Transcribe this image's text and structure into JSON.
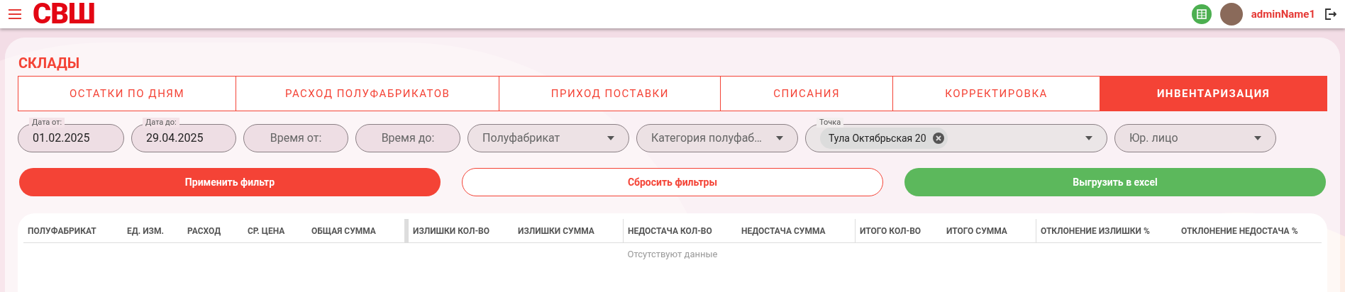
{
  "header": {
    "logo": "СВШ",
    "user": "adminName1"
  },
  "page": {
    "title": "СКЛАДЫ"
  },
  "tabs": [
    {
      "label": "ОСТАТКИ ПО ДНЯМ",
      "selected": false
    },
    {
      "label": "РАСХОД ПОЛУФАБРИКАТОВ",
      "selected": false
    },
    {
      "label": "ПРИХОД ПОСТАВКИ",
      "selected": false
    },
    {
      "label": "СПИСАНИЯ",
      "selected": false
    },
    {
      "label": "КОРРЕКТИРОВКА",
      "selected": false
    },
    {
      "label": "ИНВЕНТАРИЗАЦИЯ",
      "selected": true
    }
  ],
  "filters": [
    {
      "kind": "date",
      "label": "Дата от:",
      "value": "01.02.2025"
    },
    {
      "kind": "date",
      "label": "Дата до:",
      "value": "29.04.2025"
    },
    {
      "kind": "text",
      "placeholder": "Время от:"
    },
    {
      "kind": "text",
      "placeholder": "Время до:"
    },
    {
      "kind": "select",
      "placeholder": "Полуфабрикат"
    },
    {
      "kind": "select",
      "placeholder": "Категория полуфаб…"
    },
    {
      "kind": "chips",
      "label": "Точка",
      "chips": [
        "Тула Октябрьская 20"
      ]
    },
    {
      "kind": "select",
      "placeholder": "Юр. лицо"
    }
  ],
  "buttons": [
    {
      "kind": "primary",
      "label": "Применить фильтр"
    },
    {
      "kind": "outline",
      "label": "Сбросить фильтры"
    },
    {
      "kind": "success",
      "label": "Выгрузить в excel"
    }
  ],
  "table": {
    "column_groups": [
      [
        "ПОЛУФАБРИКАТ",
        "ЕД. ИЗМ.",
        "РАСХОД",
        "СР. ЦЕНА",
        "ОБЩАЯ СУММА"
      ],
      [
        "ИЗЛИШКИ КОЛ-ВО",
        "ИЗЛИШКИ СУММА"
      ],
      [
        "НЕДОСТАЧА КОЛ-ВО",
        "НЕДОСТАЧА СУММА"
      ],
      [
        "ИТОГО КОЛ-ВО",
        "ИТОГО СУММА"
      ],
      [
        "ОТКЛОНЕНИЕ ИЗЛИШКИ %",
        "ОТКЛОНЕНИЕ НЕДОСТАЧА %"
      ]
    ],
    "empty_text": "Отсутствуют данные"
  }
}
